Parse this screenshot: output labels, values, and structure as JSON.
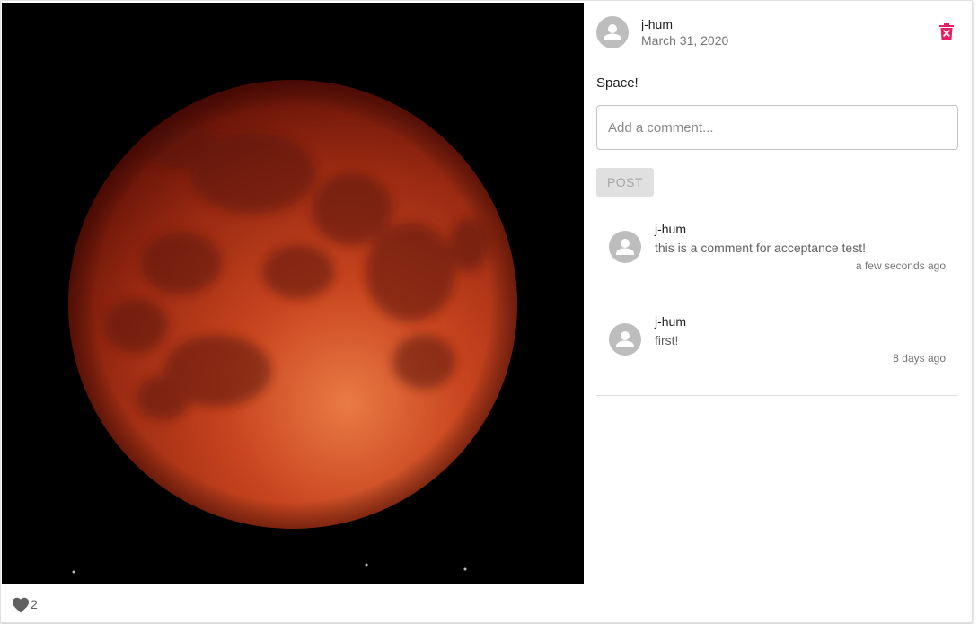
{
  "post": {
    "author": "j-hum",
    "date": "March 31, 2020",
    "caption": "Space!",
    "photo_subject": "red lunar eclipse moon on black sky",
    "delete_icon": "trash-icon",
    "delete_color": "#e91e63"
  },
  "comment_form": {
    "placeholder": "Add a comment...",
    "post_label": "POST"
  },
  "comments": [
    {
      "author": "j-hum",
      "text": "this is a comment for acceptance test!",
      "time": "a few seconds ago"
    },
    {
      "author": "j-hum",
      "text": "first!",
      "time": "8 days ago"
    }
  ],
  "likes": {
    "icon": "heart-icon",
    "count": "2"
  },
  "colors": {
    "avatar_bg": "#bdbdbd",
    "heart": "#616161",
    "moon_dark": "#6e1208",
    "moon_light": "#e0673a"
  }
}
